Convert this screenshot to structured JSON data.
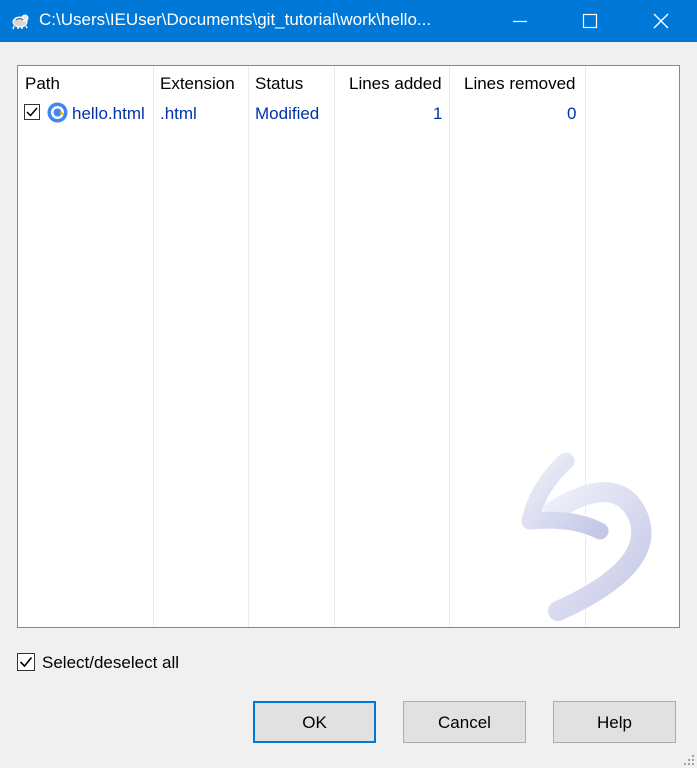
{
  "window": {
    "title": "C:\\Users\\IEUser\\Documents\\git_tutorial\\work\\hello...",
    "accent_color": "#0078d7",
    "title_icon": "tortoisegit-icon"
  },
  "list": {
    "columns": [
      "Path",
      "Extension",
      "Status",
      "Lines added",
      "Lines removed"
    ],
    "rows": [
      {
        "checked": true,
        "icon": "chrome-html-file-icon",
        "path": "hello.html",
        "extension": ".html",
        "status": "Modified",
        "lines_added": "1",
        "lines_removed": "0"
      }
    ],
    "text_color": "#0033aa"
  },
  "select_all": {
    "label": "Select/deselect all",
    "checked": true
  },
  "buttons": {
    "ok": "OK",
    "cancel": "Cancel",
    "help": "Help"
  }
}
